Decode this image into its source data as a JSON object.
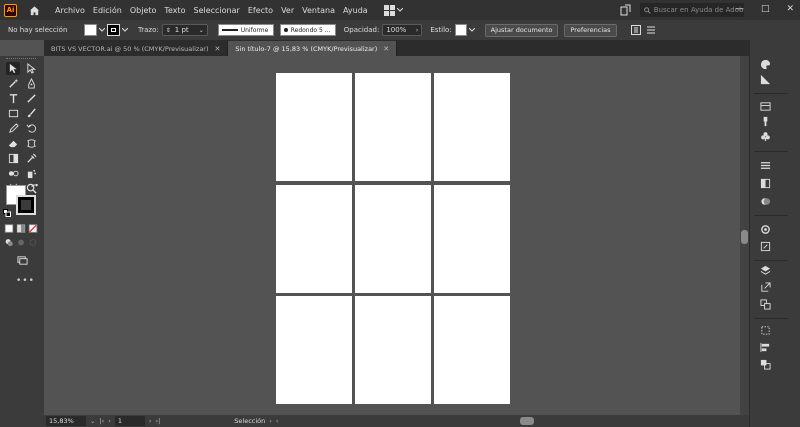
{
  "app": {
    "logo_text": "Ai"
  },
  "menu": {
    "items": [
      "Archivo",
      "Edición",
      "Objeto",
      "Texto",
      "Seleccionar",
      "Efecto",
      "Ver",
      "Ventana",
      "Ayuda"
    ]
  },
  "search": {
    "placeholder": "Buscar en Ayuda de Adobe"
  },
  "window_controls": {
    "minimize": "—",
    "maximize": "□",
    "close": "✕"
  },
  "control_bar": {
    "selection_status": "No hay selección",
    "stroke_label": "Trazo:",
    "stroke_weight": "1 pt",
    "stroke_profile": "Uniforme",
    "brush": "Redondo 5 ...",
    "opacity_label": "Opacidad:",
    "opacity_value": "100%",
    "style_label": "Estilo:",
    "document_setup_button": "Ajustar documento",
    "preferences_button": "Preferencias"
  },
  "tabs": [
    {
      "label": "BITS VS VECTOR.ai @ 50 % (CMYK/Previsualizar)",
      "active": false
    },
    {
      "label": "Sin título-7 @ 15,83 % (CMYK/Previsualizar)",
      "active": true
    }
  ],
  "tab_close": "✕",
  "toolbar": {
    "more_tools": "•••"
  },
  "artboards": {
    "columns": 3,
    "rows": 3,
    "count": 9,
    "color": "#ffffff"
  },
  "statusbar": {
    "zoom": "15,83%",
    "artboard_number": "1",
    "status_text": "Selección"
  },
  "colors": {
    "workspace_bg": "#535353",
    "panel_bg": "#3b3b3b",
    "menubar_bg": "#323232",
    "accent_logo": "#ff9a00"
  }
}
